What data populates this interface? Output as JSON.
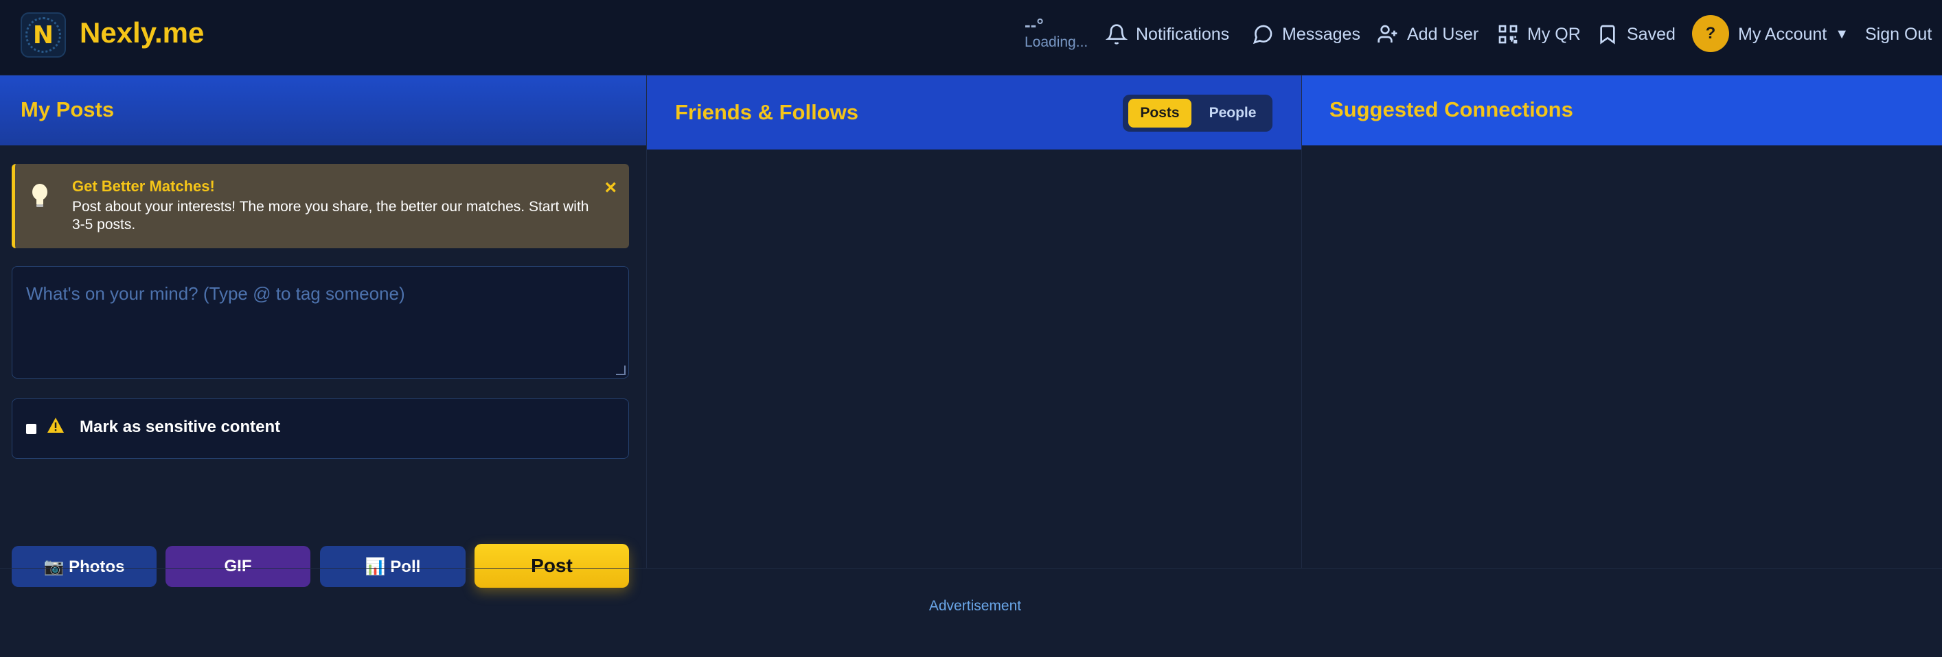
{
  "header": {
    "brand": "Nexly.me",
    "logo_letter": "N",
    "weather": {
      "temp": "--°",
      "status": "Loading..."
    },
    "nav": {
      "notifications": "Notifications",
      "messages": "Messages",
      "add_user": "Add User",
      "my_qr": "My QR",
      "saved": "Saved",
      "account": "My Account",
      "account_caret": "▼",
      "sign_out": "Sign Out"
    },
    "avatar_initial": "?"
  },
  "my_posts": {
    "title": "My Posts",
    "tip": {
      "title": "Get Better Matches!",
      "body": "Post about your interests! The more you share, the better our matches. Start with 3-5 posts.",
      "close": "×"
    },
    "composer_placeholder": "What's on your mind? (Type @ to tag someone)",
    "sensitive_label": "Mark as sensitive content",
    "buttons": {
      "photos": "📷 Photos",
      "gif": "GIF",
      "poll": "📊 Poll",
      "post": "Post"
    }
  },
  "friends": {
    "title": "Friends & Follows",
    "toggle": {
      "posts": "Posts",
      "people": "People",
      "active": "Posts"
    }
  },
  "suggested": {
    "title": "Suggested Connections"
  },
  "footer": {
    "ad_label": "Advertisement"
  },
  "colors": {
    "accent": "#f5c518",
    "background": "#141d31",
    "header_bg": "#0d1528",
    "panel_blue": "#1d46c6"
  }
}
